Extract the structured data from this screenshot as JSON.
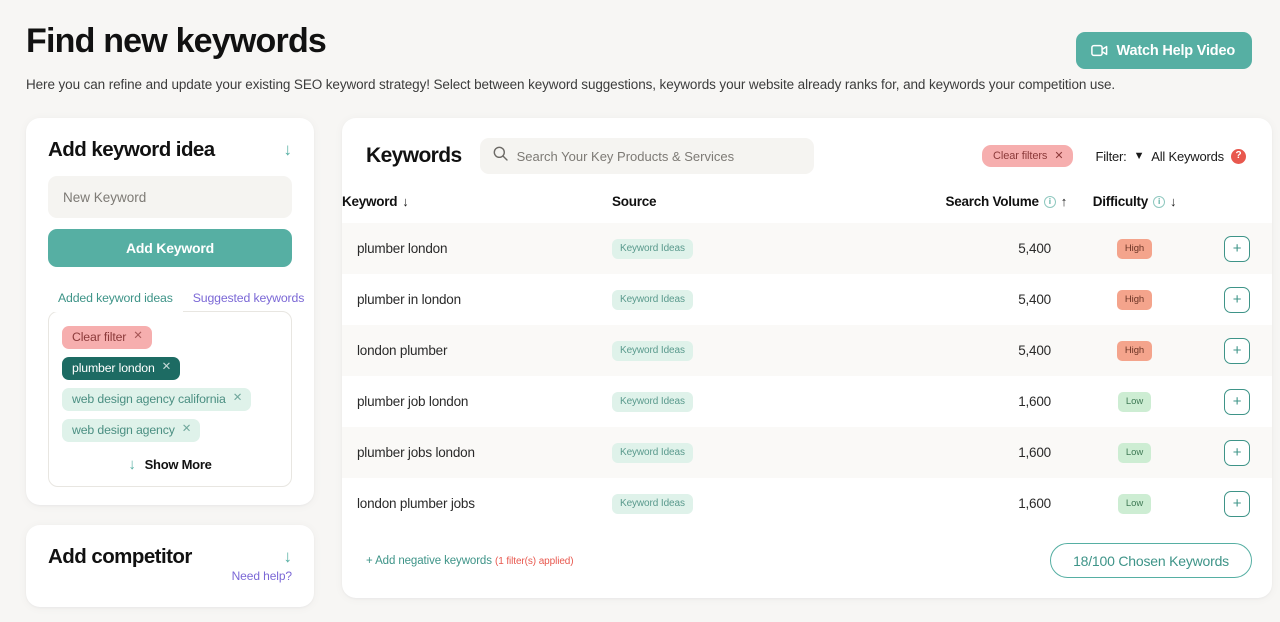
{
  "header": {
    "title": "Find new keywords",
    "subtitle": "Here you can refine and update your existing SEO keyword strategy! Select between keyword suggestions, keywords your website already ranks for, and keywords your competition use.",
    "help_video_label": "Watch Help Video",
    "help_video_icon": "video-camera-icon"
  },
  "sidebar": {
    "keyword_idea": {
      "title": "Add keyword idea",
      "collapse_icon": "arrow-down-icon",
      "input_placeholder": "New Keyword",
      "input_value": "",
      "add_button_label": "Add Keyword",
      "tabs": [
        {
          "label": "Added keyword ideas",
          "active": true
        },
        {
          "label": "Suggested keywords",
          "active": false
        }
      ],
      "chips": [
        {
          "label": "Clear filter",
          "style": "pink",
          "close_icon": "close-icon"
        },
        {
          "label": "plumber london",
          "style": "dark",
          "close_icon": "close-icon"
        },
        {
          "label": "web design agency california",
          "style": "mint",
          "close_icon": "close-icon"
        },
        {
          "label": "web design agency",
          "style": "mint",
          "close_icon": "close-icon"
        }
      ],
      "show_more_label": "Show More",
      "show_more_icon": "arrow-down-icon"
    },
    "competitor": {
      "title": "Add competitor",
      "collapse_icon": "arrow-down-icon",
      "need_help_label": "Need help?"
    }
  },
  "keywords_panel": {
    "heading": "Keywords",
    "search": {
      "placeholder": "Search Your Key Products & Services",
      "value": "",
      "icon": "search-icon"
    },
    "clear_filters_label": "Clear filters",
    "clear_filters_icon": "close-icon",
    "filter_label": "Filter:",
    "filter_caret_icon": "chevron-down-icon",
    "filter_value": "All Keywords",
    "filter_help_icon": "help-circle-icon",
    "columns": {
      "keyword": "Keyword",
      "keyword_sort": "↓",
      "source": "Source",
      "search_volume": "Search Volume",
      "search_volume_sort": "↑",
      "difficulty": "Difficulty",
      "difficulty_sort": "↓",
      "info_icon": "info-icon"
    },
    "rows": [
      {
        "keyword": "plumber london",
        "source": "Keyword Ideas",
        "volume": "5,400",
        "difficulty": "High",
        "difficulty_level": "high",
        "action_icon": "plus-icon"
      },
      {
        "keyword": "plumber in london",
        "source": "Keyword Ideas",
        "volume": "5,400",
        "difficulty": "High",
        "difficulty_level": "high",
        "action_icon": "plus-icon"
      },
      {
        "keyword": "london plumber",
        "source": "Keyword Ideas",
        "volume": "5,400",
        "difficulty": "High",
        "difficulty_level": "high",
        "action_icon": "plus-icon"
      },
      {
        "keyword": "plumber job london",
        "source": "Keyword Ideas",
        "volume": "1,600",
        "difficulty": "Low",
        "difficulty_level": "low",
        "action_icon": "plus-icon"
      },
      {
        "keyword": "plumber jobs london",
        "source": "Keyword Ideas",
        "volume": "1,600",
        "difficulty": "Low",
        "difficulty_level": "low",
        "action_icon": "plus-icon"
      },
      {
        "keyword": "london plumber jobs",
        "source": "Keyword Ideas",
        "volume": "1,600",
        "difficulty": "Low",
        "difficulty_level": "low",
        "action_icon": "plus-icon"
      }
    ],
    "footer": {
      "negative_keywords_label": "+ Add negative keywords",
      "filters_applied": "(1 filter(s) applied)",
      "chosen_keywords_label": "18/100 Chosen Keywords"
    }
  },
  "colors": {
    "accent_teal": "#56AFA3",
    "accent_teal_dark": "#3E9488",
    "chip_dark": "#1D6B63",
    "chip_mint": "#DFF2EA",
    "chip_pink": "#F6AEAE",
    "badge_high": "#F4A48C",
    "badge_low": "#CDEDD3",
    "purple": "#7B68D6",
    "red": "#E8584E",
    "page_bg": "#F7F6F4",
    "card_bg": "#FFFFFF"
  }
}
